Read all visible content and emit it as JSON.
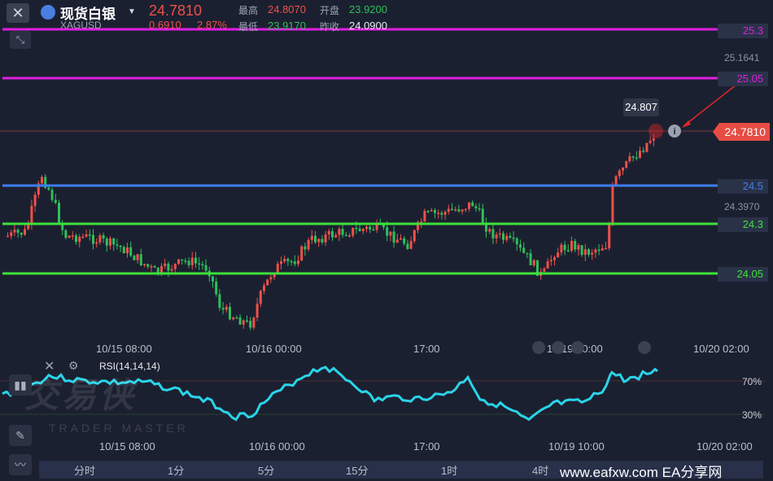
{
  "header": {
    "close_icon": "close-icon",
    "symbol_name": "现货白银",
    "symbol_code": "XAGUSD",
    "price": "24.7810",
    "change": "0.6910",
    "change_pct": "2.87%",
    "high_label": "最高",
    "high_value": "24.8070",
    "low_label": "最低",
    "low_value": "23.9170",
    "open_label": "开盘",
    "open_value": "23.9200",
    "prev_close_label": "昨收",
    "prev_close_value": "24.0900"
  },
  "levels": [
    {
      "label": "25.3",
      "color": "#e01ee0"
    },
    {
      "label": "25.05",
      "color": "#e01ee0"
    },
    {
      "label": "24.5",
      "color": "#3f7ef0"
    },
    {
      "label": "24.3",
      "color": "#3ee03a"
    },
    {
      "label": "24.05",
      "color": "#3ee03a"
    }
  ],
  "axis_prices": {
    "top": "25.1641",
    "mid": "24.3970"
  },
  "current_price_tag": "24.7810",
  "tooltip_value": "24.807",
  "x_labels": {
    "d1": "10/15 08:00",
    "d2": "10/16 00:00",
    "d3": "17:00",
    "d4": "10/19 10:00",
    "d5": "10/20 02:00"
  },
  "rsi": {
    "label": "RSI(14,14,14)",
    "tick_70": "70%",
    "tick_30": "30%"
  },
  "timeframes": [
    "分时",
    "1分",
    "5分",
    "15分",
    "1时",
    "4时"
  ],
  "watermark": {
    "title": "交易侠",
    "subtitle": "TRADER MASTER"
  },
  "site": "www.eafxw.com   EA分享网",
  "colors": {
    "up": "#f0504a",
    "down": "#2fbf5a",
    "bg": "#1b2030",
    "rsi": "#2ad4e8"
  }
}
